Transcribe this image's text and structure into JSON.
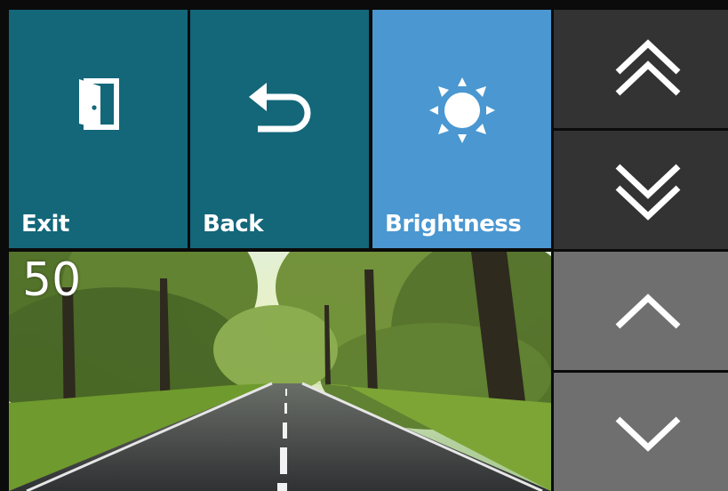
{
  "tiles": {
    "exit_label": "Exit",
    "back_label": "Back",
    "brightness_label": "Brightness"
  },
  "preview": {
    "brightness_value": "50"
  },
  "icons": {
    "exit": "exit-door-icon",
    "back": "back-arrow-icon",
    "brightness": "sun-icon",
    "fast_up": "double-chevron-up-icon",
    "fast_down": "double-chevron-down-icon",
    "step_up": "chevron-up-icon",
    "step_down": "chevron-down-icon"
  },
  "colors": {
    "tile_teal": "#136779",
    "tile_active_blue": "#4a97d1",
    "nav_dark": "#333333",
    "nav_grey": "#6f6f6f"
  }
}
